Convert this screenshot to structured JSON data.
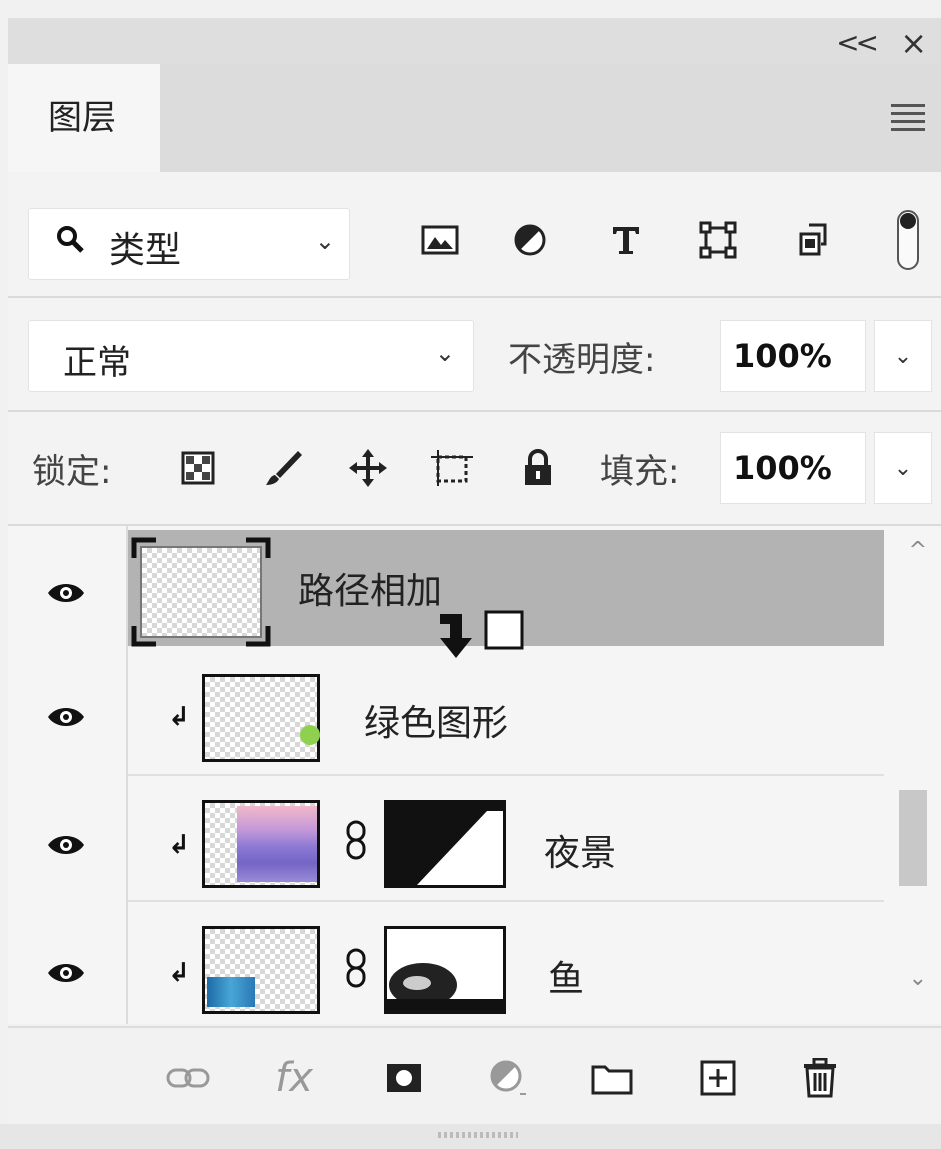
{
  "window": {
    "collapse_label": "<<",
    "close_label": "×"
  },
  "tabs": [
    {
      "label": "图层",
      "active": true
    }
  ],
  "filter": {
    "search_icon": "search-icon",
    "selected": "类型",
    "icons": [
      "image-filter-icon",
      "adjustment-filter-icon",
      "type-filter-icon",
      "shape-filter-icon",
      "smart-object-filter-icon"
    ]
  },
  "blend": {
    "mode": "正常",
    "opacity_label": "不透明度:",
    "opacity_value": "100%"
  },
  "lock": {
    "label": "锁定:",
    "icons": [
      "lock-transparent-pixels-icon",
      "lock-image-pixels-icon",
      "lock-position-icon",
      "lock-artboard-icon",
      "lock-all-icon"
    ],
    "fill_label": "填充:",
    "fill_value": "100%"
  },
  "layers": [
    {
      "name": "路径相加",
      "visible": true,
      "selected": true,
      "clipped": false,
      "has_mask": false
    },
    {
      "name": "绿色图形",
      "visible": true,
      "selected": false,
      "clipped": true,
      "has_mask": false
    },
    {
      "name": "夜景",
      "visible": true,
      "selected": false,
      "clipped": true,
      "has_mask": true
    },
    {
      "name": "鱼",
      "visible": true,
      "selected": false,
      "clipped": true,
      "has_mask": true
    }
  ],
  "bottom_bar": {
    "icons": [
      "link-layers-icon",
      "fx-icon",
      "add-mask-icon",
      "new-adjustment-icon",
      "new-group-icon",
      "new-layer-icon",
      "delete-icon"
    ],
    "fx_label": "fx"
  },
  "colors": {
    "selected_row": "#b3b3b3",
    "panel_bg": "#f1f1f1",
    "tab_strip": "#dcdcdc"
  }
}
